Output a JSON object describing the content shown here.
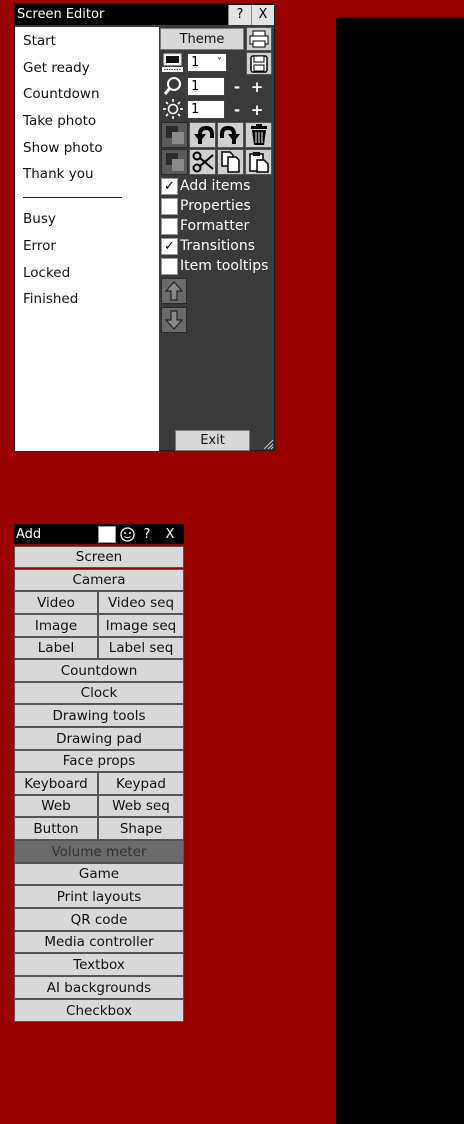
{
  "editor": {
    "title": "Screen Editor",
    "help": "?",
    "close": "X",
    "list": [
      "Start",
      "Get ready",
      "Countdown",
      "Take photo",
      "Show photo",
      "Thank you",
      "Busy",
      "Error",
      "Locked",
      "Finished"
    ],
    "theme_label": "Theme",
    "screen_select": "1",
    "screen_select_chevron": "˅",
    "zoom_value": "1",
    "brightness_value": "1",
    "minus": "-",
    "plus": "+",
    "options": [
      {
        "label": "Add items",
        "checked": true
      },
      {
        "label": "Properties",
        "checked": false
      },
      {
        "label": "Formatter",
        "checked": false
      },
      {
        "label": "Transitions",
        "checked": true
      },
      {
        "label": "Item tooltips",
        "checked": false
      }
    ],
    "check_mark": "✓",
    "exit_label": "Exit",
    "icons": [
      "monitor-icon",
      "save-icon",
      "zoom-icon",
      "brightness-icon",
      "undo-icon",
      "redo-icon",
      "delete-icon",
      "cut-icon",
      "copy-icon",
      "paste-icon",
      "move-up-icon",
      "move-down-icon"
    ]
  },
  "add_panel": {
    "title": "Add",
    "help": "?",
    "close": "X",
    "items": {
      "screen": "Screen",
      "camera": "Camera",
      "video": "Video",
      "video_seq": "Video seq",
      "image": "Image",
      "image_seq": "Image seq",
      "label": "Label",
      "label_seq": "Label seq",
      "countdown": "Countdown",
      "clock": "Clock",
      "drawing_tools": "Drawing tools",
      "drawing_pad": "Drawing pad",
      "face_props": "Face props",
      "keyboard": "Keyboard",
      "keypad": "Keypad",
      "web": "Web",
      "web_seq": "Web seq",
      "button": "Button",
      "shape": "Shape",
      "volume_meter": "Volume meter",
      "game": "Game",
      "print_layouts": "Print layouts",
      "qr_code": "QR code",
      "media_controller": "Media controller",
      "textbox": "Textbox",
      "ai_backgrounds": "AI backgrounds",
      "checkbox": "Checkbox"
    }
  },
  "colors": {
    "background": "#9a0000",
    "canvas": "#000000",
    "panel": "#3a3a3a"
  }
}
